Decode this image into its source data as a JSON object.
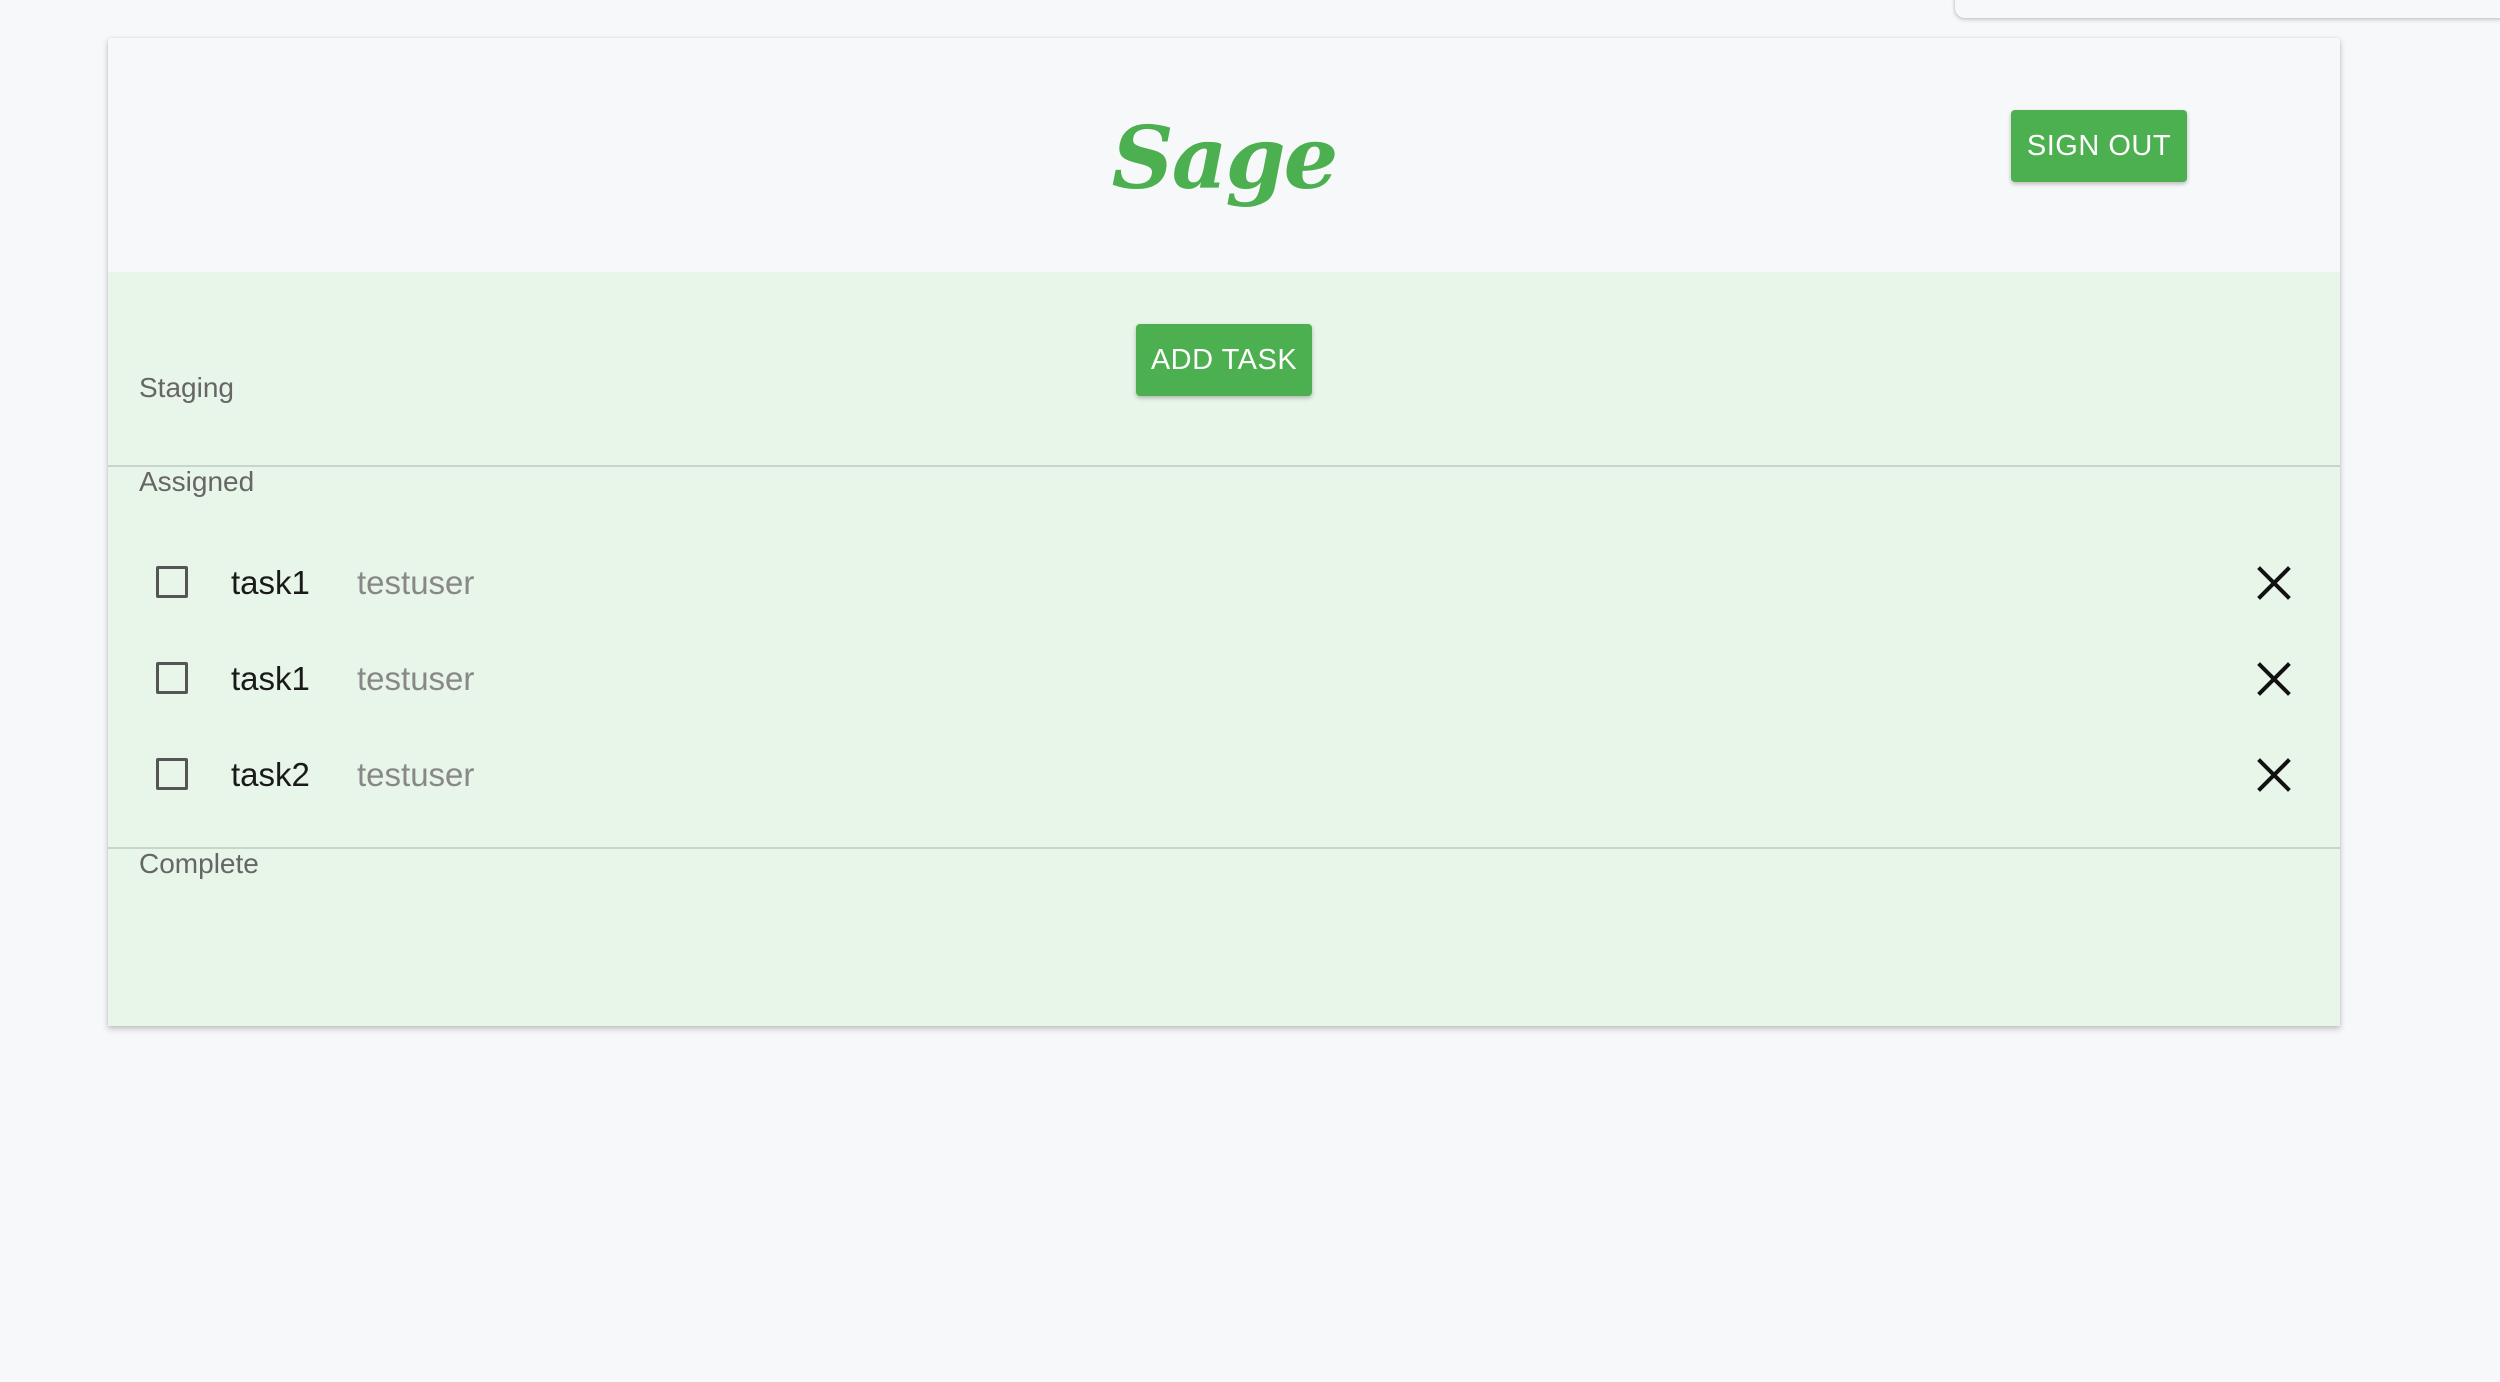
{
  "header": {
    "logo_text": "Sage",
    "sign_out_label": "SIGN OUT"
  },
  "board": {
    "add_task_label": "ADD TASK",
    "sections": {
      "staging": "Staging",
      "assigned": "Assigned",
      "complete": "Complete"
    },
    "assigned_tasks": [
      {
        "name": "task1",
        "user": "testuser",
        "checked": false
      },
      {
        "name": "task1",
        "user": "testuser",
        "checked": false
      },
      {
        "name": "task2",
        "user": "testuser",
        "checked": false
      }
    ]
  },
  "icons": {
    "delete": "close-icon",
    "checkbox": "checkbox-icon"
  },
  "colors": {
    "accent": "#4caf50",
    "board_background": "#e8f5e9",
    "page_background": "#f7f8fa"
  }
}
